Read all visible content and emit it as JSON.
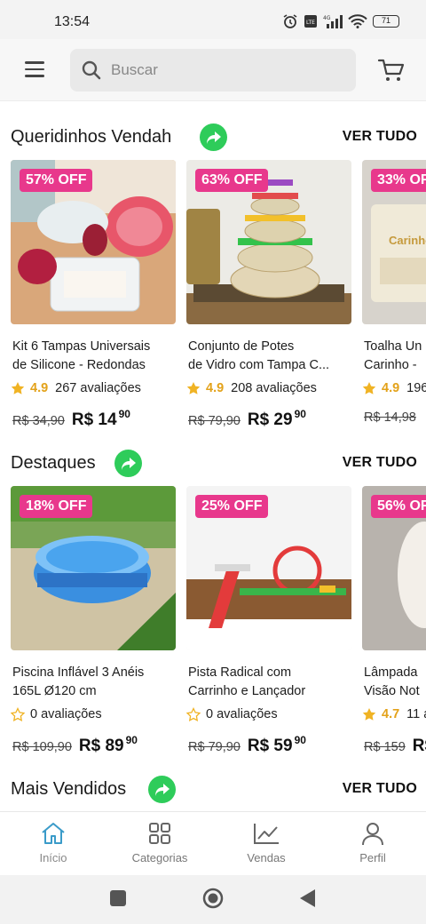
{
  "status": {
    "time": "13:54",
    "battery": "71"
  },
  "search": {
    "placeholder": "Buscar"
  },
  "sections": [
    {
      "title": "Queridinhos Vendah",
      "more": "VER TUDO",
      "products": [
        {
          "badge": "57% OFF",
          "name1": "Kit 6 Tampas Universais",
          "name2": "de Silicone - Redondas",
          "rating": "4.9",
          "reviews": "267 avaliações",
          "old_price": "R$ 34,90",
          "price": "R$ 14",
          "cents": "90",
          "rated": true
        },
        {
          "badge": "63% OFF",
          "name1": "Conjunto de Potes",
          "name2": "de Vidro com Tampa C...",
          "rating": "4.9",
          "reviews": "208 avaliações",
          "old_price": "R$ 79,90",
          "price": "R$ 29",
          "cents": "90",
          "rated": true
        },
        {
          "badge": "33% OFF",
          "name1": "Toalha Un",
          "name2": "Carinho -",
          "rating": "4.9",
          "reviews": "196",
          "old_price": "R$ 14,98",
          "price": "",
          "cents": "",
          "rated": true
        }
      ]
    },
    {
      "title": "Destaques",
      "more": "VER TUDO",
      "products": [
        {
          "badge": "18% OFF",
          "name1": "Piscina Inflável 3 Anéis",
          "name2": "165L Ø120 cm",
          "rating": "",
          "reviews": "0 avaliações",
          "old_price": "R$ 109,90",
          "price": "R$ 89",
          "cents": "90",
          "rated": false
        },
        {
          "badge": "25% OFF",
          "name1": "Pista Radical com",
          "name2": "Carrinho e Lançador",
          "rating": "",
          "reviews": "0 avaliações",
          "old_price": "R$ 79,90",
          "price": "R$ 59",
          "cents": "90",
          "rated": false
        },
        {
          "badge": "56% OFF",
          "name1": "Lâmpada",
          "name2": "Visão Not",
          "rating": "4.7",
          "reviews": "11 a",
          "old_price": "R$ 159",
          "price": "R$",
          "cents": "",
          "rated": true
        }
      ]
    },
    {
      "title": "Mais Vendidos",
      "more": "VER TUDO",
      "products": []
    }
  ],
  "nav": [
    {
      "label": "Início",
      "icon": "home-icon",
      "active": true
    },
    {
      "label": "Categorias",
      "icon": "grid-icon",
      "active": false
    },
    {
      "label": "Vendas",
      "icon": "chart-icon",
      "active": false
    },
    {
      "label": "Perfil",
      "icon": "user-icon",
      "active": false
    }
  ],
  "colors": {
    "accent": "#e8388c",
    "green": "#2ecc5a",
    "star": "#e3a21a",
    "active_nav": "#3a9bc9"
  }
}
